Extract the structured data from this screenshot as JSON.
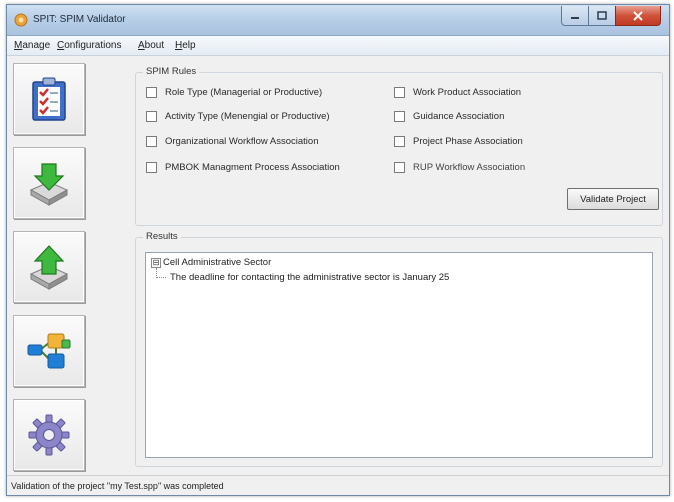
{
  "window": {
    "title": "SPIT: SPIM Validator",
    "icon": "app-icon",
    "caption_buttons": [
      "minimize-icon",
      "maximize-icon",
      "close-icon"
    ]
  },
  "menu": {
    "items": [
      "Manage",
      "Configurations",
      "About",
      "Help"
    ]
  },
  "toolbar": {
    "buttons": [
      {
        "icon": "checklist-icon",
        "accent": "#d42a2a"
      },
      {
        "icon": "import-download-icon",
        "accent": "#2fa82f"
      },
      {
        "icon": "export-upload-icon",
        "accent": "#2fa82f"
      },
      {
        "icon": "workflow-network-icon",
        "accent": "#1f7fd6"
      },
      {
        "icon": "gear-settings-icon",
        "accent": "#7a6fc9"
      }
    ]
  },
  "rules": {
    "group_label": "SPIM Rules",
    "items": [
      {
        "label": "Role Type (Managerial or Productive)",
        "checked": false
      },
      {
        "label": "Activity Type (Menengial or Productive)",
        "checked": false
      },
      {
        "label": "Organizational Workflow Association",
        "checked": false
      },
      {
        "label": "PMBOK Managment Process Association",
        "checked": false
      },
      {
        "label": "Work Product Association",
        "checked": false
      },
      {
        "label": "Guidance Association",
        "checked": false
      },
      {
        "label": "Project Phase Association",
        "checked": false
      },
      {
        "label": "RUP Workflow Association",
        "checked": false
      }
    ],
    "validate_button": "Validate Project"
  },
  "results": {
    "group_label": "Results",
    "tree": {
      "root": "Cell Administrative Sector",
      "expander": "⊟",
      "child": "The deadline for contacting the administrative sector is January 25"
    }
  },
  "status": {
    "text": "Validation of the project \"my Test.spp\" was completed"
  }
}
